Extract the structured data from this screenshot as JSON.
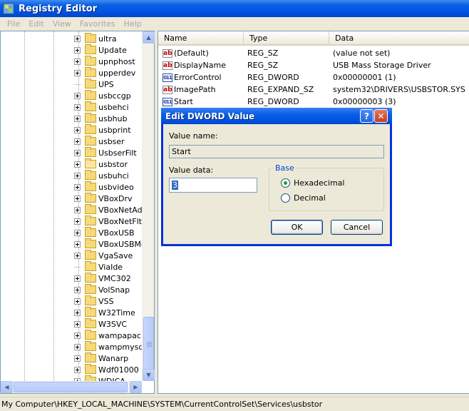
{
  "window": {
    "title": "Registry Editor"
  },
  "menu": [
    "File",
    "Edit",
    "View",
    "Favorites",
    "Help"
  ],
  "tree": {
    "items": [
      {
        "label": "ultra",
        "expandable": true
      },
      {
        "label": "Update",
        "expandable": true
      },
      {
        "label": "upnphost",
        "expandable": true
      },
      {
        "label": "upperdev",
        "expandable": true
      },
      {
        "label": "UPS",
        "expandable": false
      },
      {
        "label": "usbccgp",
        "expandable": true
      },
      {
        "label": "usbehci",
        "expandable": true
      },
      {
        "label": "usbhub",
        "expandable": true
      },
      {
        "label": "usbprint",
        "expandable": true
      },
      {
        "label": "usbser",
        "expandable": true
      },
      {
        "label": "UsbserFilt",
        "expandable": true
      },
      {
        "label": "usbstor",
        "expandable": true,
        "selected": true
      },
      {
        "label": "usbuhci",
        "expandable": true
      },
      {
        "label": "usbvideo",
        "expandable": true
      },
      {
        "label": "VBoxDrv",
        "expandable": true
      },
      {
        "label": "VBoxNetAdp",
        "expandable": true
      },
      {
        "label": "VBoxNetFlt",
        "expandable": true
      },
      {
        "label": "VBoxUSB",
        "expandable": true
      },
      {
        "label": "VBoxUSBMo",
        "expandable": true
      },
      {
        "label": "VgaSave",
        "expandable": true
      },
      {
        "label": "ViaIde",
        "expandable": false
      },
      {
        "label": "VMC302",
        "expandable": true
      },
      {
        "label": "VolSnap",
        "expandable": true
      },
      {
        "label": "VSS",
        "expandable": true
      },
      {
        "label": "W32Time",
        "expandable": true
      },
      {
        "label": "W3SVC",
        "expandable": true
      },
      {
        "label": "wampapach",
        "expandable": true
      },
      {
        "label": "wampmysqlo",
        "expandable": true
      },
      {
        "label": "Wanarp",
        "expandable": true
      },
      {
        "label": "Wdf01000",
        "expandable": true
      },
      {
        "label": "WDICA",
        "expandable": true
      }
    ]
  },
  "list": {
    "columns": [
      "Name",
      "Type",
      "Data"
    ],
    "rows": [
      {
        "icon": "string-value-icon",
        "name": "(Default)",
        "type": "REG_SZ",
        "data": "(value not set)"
      },
      {
        "icon": "string-value-icon",
        "name": "DisplayName",
        "type": "REG_SZ",
        "data": "USB Mass Storage Driver"
      },
      {
        "icon": "binary-value-icon",
        "name": "ErrorControl",
        "type": "REG_DWORD",
        "data": "0x00000001 (1)"
      },
      {
        "icon": "string-value-icon",
        "name": "ImagePath",
        "type": "REG_EXPAND_SZ",
        "data": "system32\\DRIVERS\\USBSTOR.SYS"
      },
      {
        "icon": "binary-value-icon",
        "name": "Start",
        "type": "REG_DWORD",
        "data": "0x00000003 (3)"
      }
    ]
  },
  "status": {
    "path": "My Computer\\HKEY_LOCAL_MACHINE\\SYSTEM\\CurrentControlSet\\Services\\usbstor"
  },
  "dialog": {
    "title": "Edit DWORD Value",
    "value_name_label": "Value name:",
    "value_name": "Start",
    "value_data_label": "Value data:",
    "value_data": "3",
    "base_label": "Base",
    "hex_label": "Hexadecimal",
    "dec_label": "Decimal",
    "base_selected": "Hexadecimal",
    "ok_label": "OK",
    "cancel_label": "Cancel",
    "help_glyph": "?",
    "close_glyph": "✕"
  }
}
